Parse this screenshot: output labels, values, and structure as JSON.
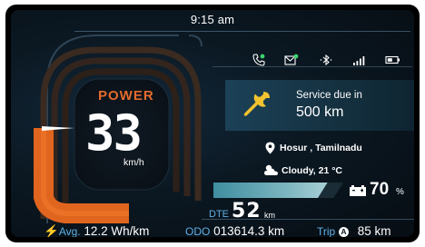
{
  "status": {
    "time": "9:15 am",
    "icons": [
      "phone-call-icon",
      "message-icon",
      "bluetooth-icon",
      "signal-icon",
      "battery-icon"
    ],
    "indicator_color": "#3bd46b"
  },
  "gauge": {
    "mode": "POWER",
    "speed": "33",
    "speed_unit": "km/h",
    "mode_color": "#e26a2c"
  },
  "service": {
    "title": "Service due in",
    "value": "500 km",
    "icon": "wrench-icon",
    "icon_color": "#f2c230"
  },
  "location": {
    "place": "Hosur , Tamilnadu",
    "weather": "Cloudy, 21 °C"
  },
  "battery": {
    "percent": "70",
    "unit": "%",
    "level": 0.7
  },
  "dte": {
    "label": "DTE",
    "value": "52",
    "unit": "km"
  },
  "footer": {
    "avg_label": "Avg.",
    "avg_value": "12.2 Wh/km",
    "odo_label": "ODO",
    "odo_value": "013614.3 km",
    "trip_label": "Trip",
    "trip_mode": "A",
    "trip_value": "85 km"
  }
}
